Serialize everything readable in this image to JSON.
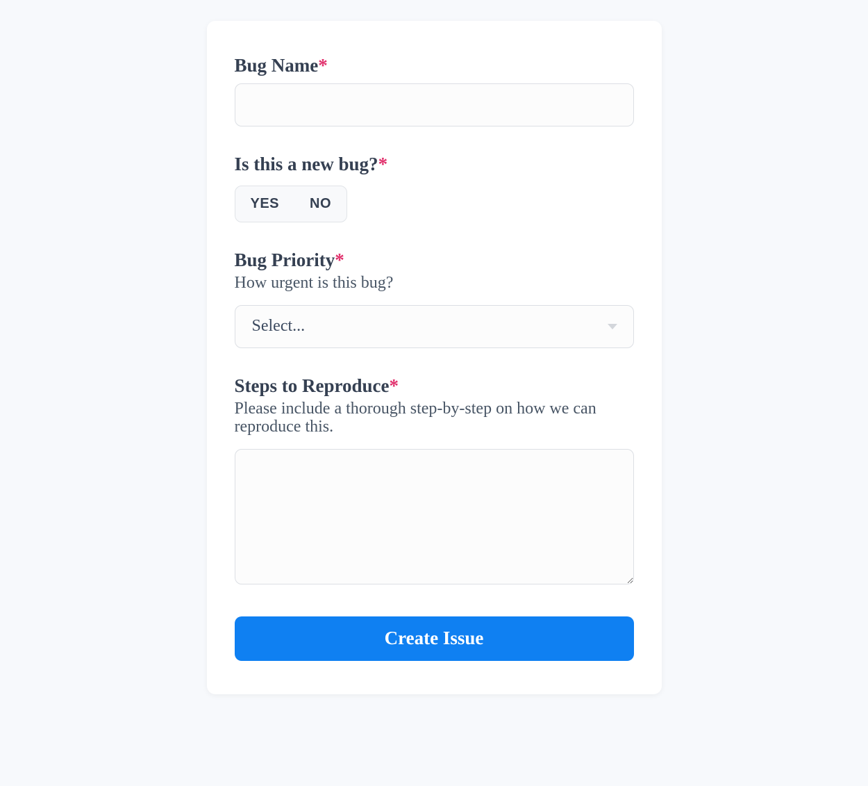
{
  "form": {
    "bug_name": {
      "label": "Bug Name",
      "required_mark": "*",
      "value": ""
    },
    "new_bug": {
      "label": "Is this a new bug?",
      "required_mark": "*",
      "options": {
        "yes": "YES",
        "no": "NO"
      }
    },
    "priority": {
      "label": "Bug Priority",
      "required_mark": "*",
      "sublabel": "How urgent is this bug?",
      "placeholder": "Select..."
    },
    "steps": {
      "label": "Steps to Reproduce",
      "required_mark": "*",
      "sublabel": "Please include a thorough step-by-step on how we can reproduce this.",
      "value": ""
    },
    "submit_label": "Create Issue"
  }
}
